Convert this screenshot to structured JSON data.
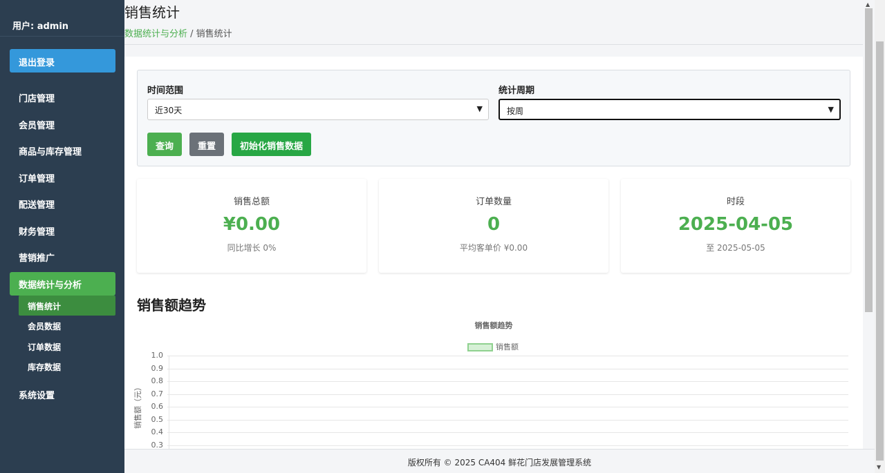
{
  "sidebar": {
    "user": "用户: admin",
    "logout": "退出登录",
    "menu": [
      "门店管理",
      "会员管理",
      "商品与库存管理",
      "订单管理",
      "配送管理",
      "财务管理",
      "营销推广"
    ],
    "active": "数据统计与分析",
    "submenu": [
      "销售统计",
      "会员数据",
      "订单数据",
      "库存数据"
    ],
    "after": "系统设置"
  },
  "header": {
    "title": "销售统计",
    "breadcrumb_link": "数据统计与分析",
    "breadcrumb_sep": " / ",
    "breadcrumb_current": "销售统计"
  },
  "filter": {
    "range_label": "时间范围",
    "range_value": "近30天",
    "period_label": "统计周期",
    "period_value": "按周",
    "query": "查询",
    "reset": "重置",
    "init": "初始化销售数据"
  },
  "cards": [
    {
      "title": "销售总额",
      "value": "¥0.00",
      "sub": "同比增长 0%"
    },
    {
      "title": "订单数量",
      "value": "0",
      "sub": "平均客单价 ¥0.00"
    },
    {
      "title": "时段",
      "value": "2025-04-05",
      "sub": "至 2025-05-05"
    }
  ],
  "section_title": "销售额趋势",
  "chart_data": {
    "type": "bar",
    "title": "销售额趋势",
    "series": [
      {
        "name": "销售额",
        "values": []
      }
    ],
    "ylabel": "销售额（元）",
    "yticks": [
      "1.0",
      "0.9",
      "0.8",
      "0.7",
      "0.6",
      "0.5",
      "0.4",
      "0.3"
    ],
    "ylim": [
      0,
      1.0
    ],
    "grid": true,
    "legend": "top-center"
  },
  "footer": "版权所有 © 2025 CA404 鲜花门店发展管理系统",
  "colors": {
    "sidebar": "#2c3e50",
    "accent": "#4caf50",
    "logout": "#3498db"
  }
}
